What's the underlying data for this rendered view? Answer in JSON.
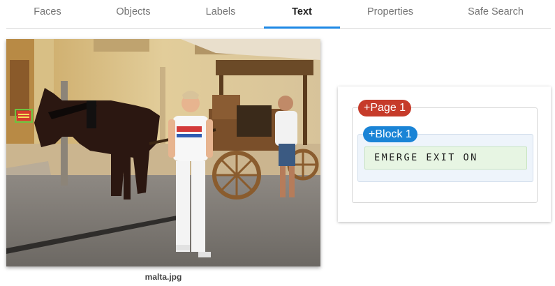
{
  "tabs": [
    {
      "label": "Faces"
    },
    {
      "label": "Objects"
    },
    {
      "label": "Labels"
    },
    {
      "label": "Text",
      "active": true
    },
    {
      "label": "Properties"
    },
    {
      "label": "Safe Search"
    }
  ],
  "image": {
    "filename": "malta.jpg"
  },
  "result": {
    "page_label": "+Page 1",
    "block_label": "+Block 1",
    "text": "EMERGE EXIT ON",
    "colors": {
      "page": "#c63b2a",
      "block": "#1a84d6",
      "paragraph_bg": "#e7f5e3",
      "tab_indicator": "#1e88e5"
    }
  }
}
